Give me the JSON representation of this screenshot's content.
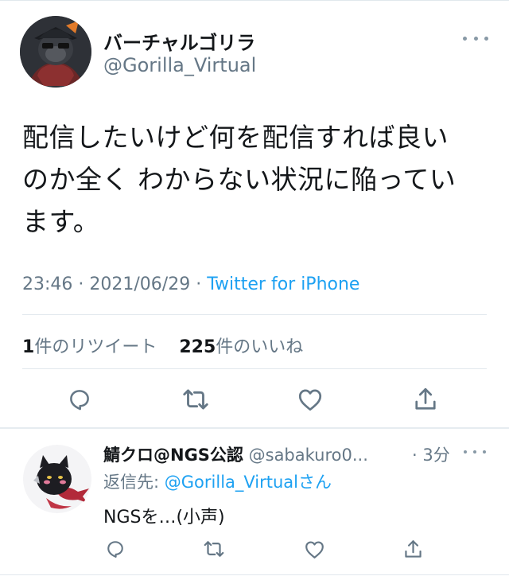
{
  "main_tweet": {
    "display_name": "バーチャルゴリラ",
    "handle": "@Gorilla_Virtual",
    "text_lines": [
      "配信したいけど何を配信すれば良い",
      "のか全く わからない状況に陥ってい",
      "ます。"
    ],
    "time": "23:46",
    "date": "2021/06/29",
    "separator": "·",
    "source": "Twitter for iPhone",
    "retweet_count": "1",
    "retweet_label": "件のリツイート",
    "like_count": "225",
    "like_label": "件のいいね"
  },
  "reply_tweet": {
    "display_name": "鯖クロ@NGS公認",
    "handle": "@sabakuro0...",
    "time": "· 3分",
    "reply_to_prefix": "返信先: ",
    "reply_to_mention": "@Gorilla_Virtual",
    "reply_to_suffix": "さん",
    "text": "NGSを…(小声)"
  },
  "icons": {
    "reply": "reply-icon",
    "retweet": "retweet-icon",
    "like": "heart-icon",
    "share": "share-icon",
    "more": "more-icon"
  },
  "colors": {
    "accent": "#1da1f2",
    "secondary_text": "#657786",
    "primary_text": "#14171a",
    "icon": "#657786"
  }
}
